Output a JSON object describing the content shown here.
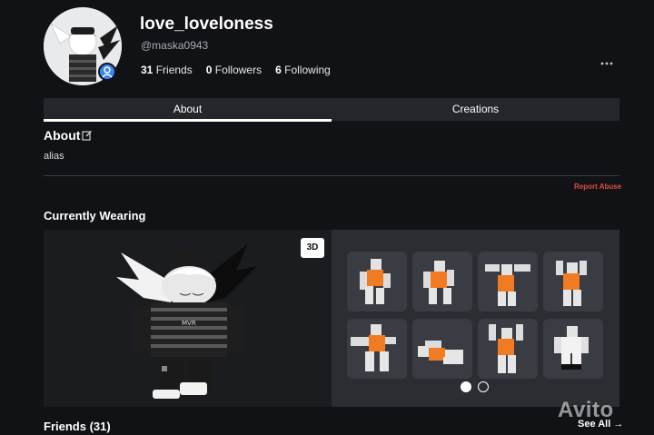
{
  "profile": {
    "username": "love_loveloness",
    "handle": "@maska0943",
    "friends_count": "31",
    "friends_label": "Friends",
    "followers_count": "0",
    "followers_label": "Followers",
    "following_count": "6",
    "following_label": "Following"
  },
  "tabs": [
    {
      "label": "About",
      "active": true
    },
    {
      "label": "Creations",
      "active": false
    }
  ],
  "about": {
    "title": "About",
    "text": "alias",
    "report_label": "Report Abuse"
  },
  "wearing": {
    "title": "Currently Wearing",
    "view_toggle": "3D",
    "avatar_text": "MVR",
    "animations": [
      "pose-1",
      "pose-2",
      "pose-3",
      "pose-4",
      "pose-5",
      "pose-6",
      "pose-7",
      "pose-8"
    ],
    "page_dots": {
      "active": 1,
      "total": 2
    }
  },
  "friends": {
    "title": "Friends (31)",
    "see_all": "See All →"
  },
  "watermark": "Avito",
  "colors": {
    "background": "#111216",
    "tab_bar": "#24262b",
    "accent_report": "#e44b3e",
    "verified": "#3c87ef",
    "torso_orange": "#f07b22"
  }
}
